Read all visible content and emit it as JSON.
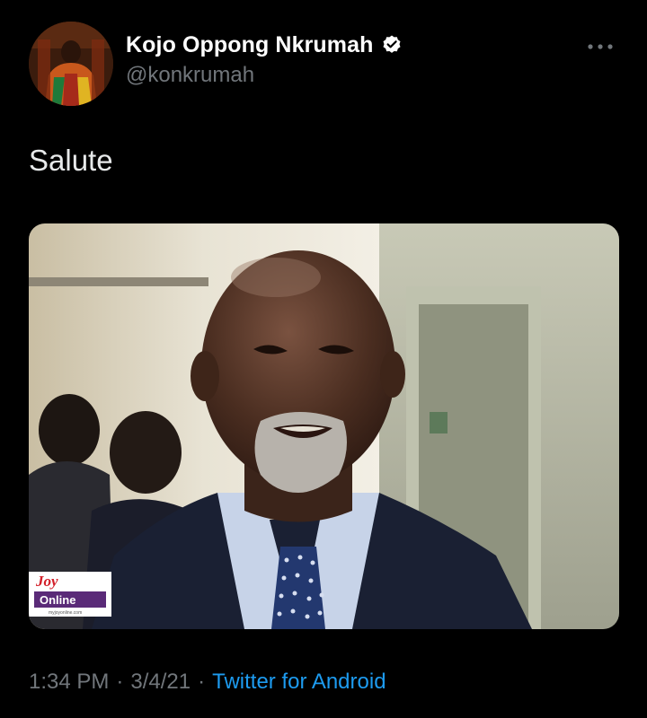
{
  "tweet": {
    "author": {
      "display_name": "Kojo Oppong Nkrumah",
      "handle": "@konkrumah",
      "verified": true,
      "avatar_icon": "profile-photo"
    },
    "more_icon": "more-horizontal-icon",
    "text": "Salute",
    "media": {
      "watermark_line1": "Joy",
      "watermark_line2": "Online",
      "watermark_url": "myjoyonline.com"
    },
    "meta": {
      "time": "1:34 PM",
      "separator": "·",
      "date": "3/4/21",
      "source": "Twitter for Android"
    },
    "colors": {
      "background": "#000000",
      "primary_text": "#e7e9ea",
      "secondary_text": "#71767b",
      "link": "#1d9bf0",
      "verified_badge": "#ffffff"
    }
  }
}
